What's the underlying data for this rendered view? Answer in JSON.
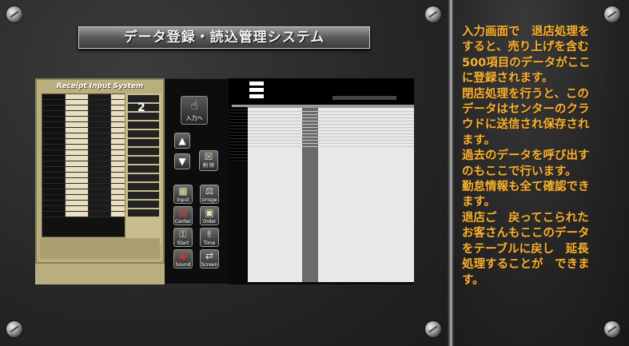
{
  "title": "データ登録・読込管理システム",
  "description_lines": [
    "入力画面で　退店処理を",
    "すると、売り上げを含む",
    "500項目のデータがここ",
    "に登録されます。",
    "閉店処理を行うと、この",
    "データはセンターのクラ",
    "ウドに送信され保存され",
    "ます。",
    "過去のデータを呼び出す",
    "のもここで行います。",
    "勤怠情報も全て確認でき",
    "ます。",
    "退店ご　戻ってこられた",
    "お客さんもここのデータ",
    "をテーブルに戻し　延長",
    "処理することが　できま",
    "す。"
  ],
  "receipt": {
    "title": "Receipt Input System",
    "number": "2"
  },
  "buttons": {
    "enter": {
      "label": "入力へ",
      "icon": "enter-icon"
    },
    "up": {
      "icon": "triangle-up-icon"
    },
    "down": {
      "icon": "triangle-down-icon"
    },
    "delete": {
      "label": "削 除",
      "icon": "trash-icon"
    },
    "input": {
      "label": "Input",
      "icon": "keyboard-icon"
    },
    "urisage": {
      "label": "Urisge",
      "icon": "scale-icon"
    },
    "center": {
      "label": "Center",
      "icon": "server-icon"
    },
    "order": {
      "label": "Order",
      "icon": "box-icon"
    },
    "start": {
      "label": "Start",
      "icon": "key-icon"
    },
    "time": {
      "label": "Time",
      "icon": "handshake-icon"
    },
    "sound": {
      "label": "Sound",
      "icon": "speaker-icon"
    },
    "screen": {
      "label": "Screen",
      "icon": "arrows-icon"
    }
  },
  "colors": {
    "accent_text": "#f2b23a",
    "receipt_bg": "#b9ae7e",
    "panel_bg": "#2a2a2a"
  }
}
